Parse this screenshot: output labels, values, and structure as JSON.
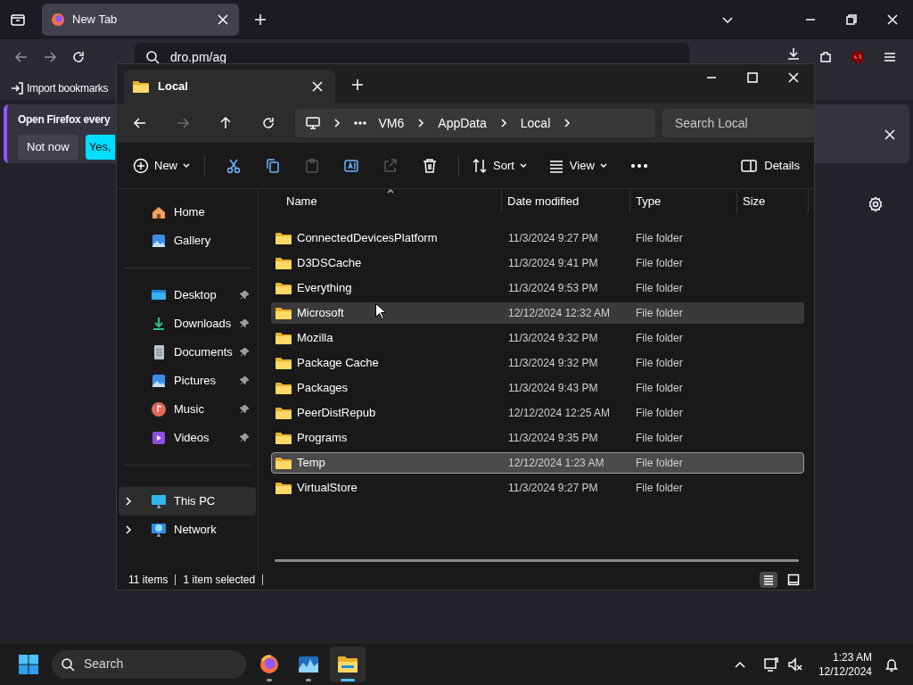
{
  "browser": {
    "tabs": [
      {
        "label": "New Tab",
        "selected": true
      }
    ],
    "url": "dro.pm/ag",
    "bookmarks": [
      "Import bookmarks"
    ],
    "notification": {
      "text": "Open Firefox every",
      "buttons": [
        "Not now",
        "Yes,"
      ]
    }
  },
  "explorer": {
    "tabs": [
      {
        "label": "Local",
        "selected": true
      }
    ],
    "breadcrumb": [
      "VM6",
      "AppData",
      "Local"
    ],
    "search": {
      "placeholder": "Search Local"
    },
    "toolbar": {
      "new": "New",
      "sort": "Sort",
      "view": "View",
      "details": "Details"
    },
    "sidebar": [
      [
        {
          "label": "Home",
          "kind": "home",
          "selected": false
        },
        {
          "label": "Gallery",
          "kind": "gallery",
          "selected": false
        }
      ],
      [
        {
          "label": "Desktop",
          "kind": "desktop",
          "pinned": true,
          "selected": false
        },
        {
          "label": "Downloads",
          "kind": "downloads",
          "pinned": true,
          "selected": false
        },
        {
          "label": "Documents",
          "kind": "documents",
          "pinned": true,
          "selected": false
        },
        {
          "label": "Pictures",
          "kind": "pictures",
          "pinned": true,
          "selected": false
        },
        {
          "label": "Music",
          "kind": "music",
          "pinned": true,
          "selected": false
        },
        {
          "label": "Videos",
          "kind": "videos",
          "pinned": true,
          "selected": false
        }
      ],
      [
        {
          "label": "This PC",
          "kind": "pc",
          "expanded": false,
          "selected": true
        },
        {
          "label": "Network",
          "kind": "network",
          "expanded": false,
          "selected": false
        }
      ]
    ],
    "columns": [
      "Name",
      "Date modified",
      "Type",
      "Size"
    ],
    "rows": [
      {
        "name": "ConnectedDevicesPlatform",
        "date": "11/3/2024 9:27 PM",
        "type": "File folder",
        "selected": false,
        "hovered": false
      },
      {
        "name": "D3DSCache",
        "date": "11/3/2024 9:41 PM",
        "type": "File folder",
        "selected": false,
        "hovered": false
      },
      {
        "name": "Everything",
        "date": "11/3/2024 9:53 PM",
        "type": "File folder",
        "selected": false,
        "hovered": false
      },
      {
        "name": "Microsoft",
        "date": "12/12/2024 12:32 AM",
        "type": "File folder",
        "selected": false,
        "hovered": true
      },
      {
        "name": "Mozilla",
        "date": "11/3/2024 9:32 PM",
        "type": "File folder",
        "selected": false,
        "hovered": false
      },
      {
        "name": "Package Cache",
        "date": "11/3/2024 9:32 PM",
        "type": "File folder",
        "selected": false,
        "hovered": false
      },
      {
        "name": "Packages",
        "date": "11/3/2024 9:43 PM",
        "type": "File folder",
        "selected": false,
        "hovered": false
      },
      {
        "name": "PeerDistRepub",
        "date": "12/12/2024 12:25 AM",
        "type": "File folder",
        "selected": false,
        "hovered": false
      },
      {
        "name": "Programs",
        "date": "11/3/2024 9:35 PM",
        "type": "File folder",
        "selected": false,
        "hovered": false
      },
      {
        "name": "Temp",
        "date": "12/12/2024 1:23 AM",
        "type": "File folder",
        "selected": true,
        "hovered": false
      },
      {
        "name": "VirtualStore",
        "date": "11/3/2024 9:27 PM",
        "type": "File folder",
        "selected": false,
        "hovered": false
      }
    ],
    "status": {
      "count": "11 items",
      "selection": "1 item selected"
    }
  },
  "taskbar": {
    "search": {
      "placeholder": "Search"
    },
    "apps": [
      {
        "kind": "firefox",
        "active": false
      },
      {
        "kind": "monitor",
        "active": false
      },
      {
        "kind": "explorer",
        "active": true
      }
    ],
    "time": "1:23 AM",
    "date": "12/12/2024"
  }
}
